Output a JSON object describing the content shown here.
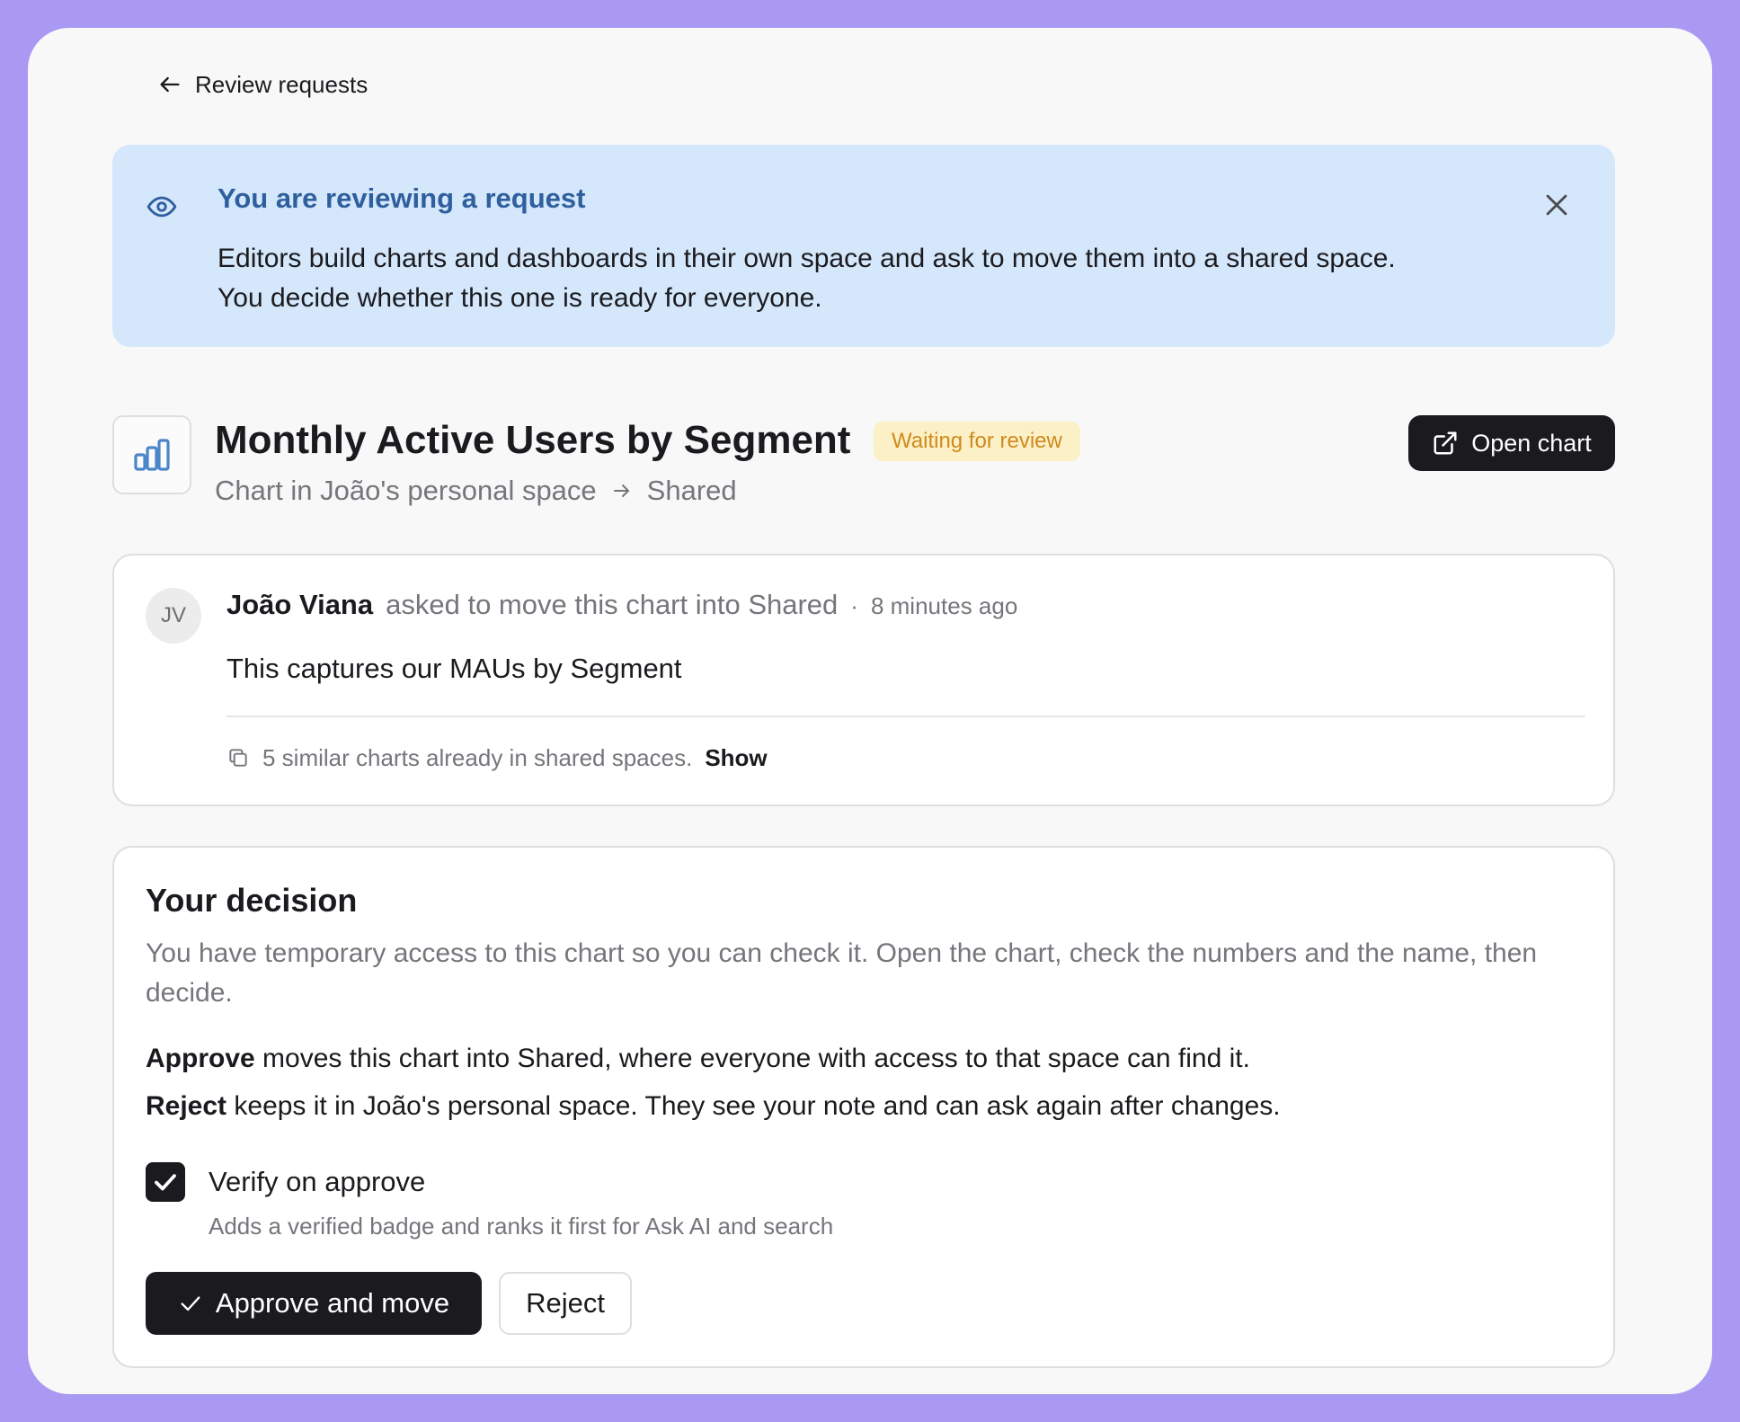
{
  "nav": {
    "back_label": "Review requests"
  },
  "banner": {
    "title": "You are reviewing a request",
    "body_line1": "Editors build charts and dashboards in their own space and ask to move them into a shared space.",
    "body_line2": "You decide whether this one is ready for everyone."
  },
  "chart": {
    "title": "Monthly Active Users by Segment",
    "status": "Waiting for review",
    "open_label": "Open chart",
    "source_space": "Chart in João's personal space",
    "target_space": "Shared"
  },
  "request": {
    "initials": "JV",
    "requester": "João Viana",
    "action": "asked to move this chart into Shared",
    "separator": "·",
    "time": "8 minutes ago",
    "message": "This captures our MAUs by Segment",
    "similar_text": "5 similar charts already in shared spaces.",
    "show_label": "Show"
  },
  "decision": {
    "title": "Your decision",
    "description": "You have temporary access to this chart so you can check it. Open the chart, check the numbers and the name, then decide.",
    "approve_term": "Approve",
    "approve_text": " moves this chart into Shared, where everyone with access to that space can find it.",
    "reject_term": "Reject",
    "reject_text": " keeps it in João's personal space. They see your note and can ask again after changes.",
    "verify_label": "Verify on approve",
    "verify_checked": true,
    "verify_help": "Adds a verified badge and ranks it first for Ask AI and search",
    "approve_button": "Approve and move",
    "reject_button": "Reject"
  },
  "colors": {
    "background": "#a999f2",
    "banner_bg": "#d5e7fb",
    "banner_title": "#2f5f9e",
    "badge_bg": "#fcf0c7",
    "badge_text": "#d08a1c",
    "chart_icon": "#4a86c8",
    "dark_button": "#1b1b1f"
  },
  "icons": [
    "arrow-left-icon",
    "eye-icon",
    "close-icon",
    "bar-chart-icon",
    "external-link-icon",
    "arrow-right-icon",
    "copy-icon",
    "check-icon"
  ]
}
